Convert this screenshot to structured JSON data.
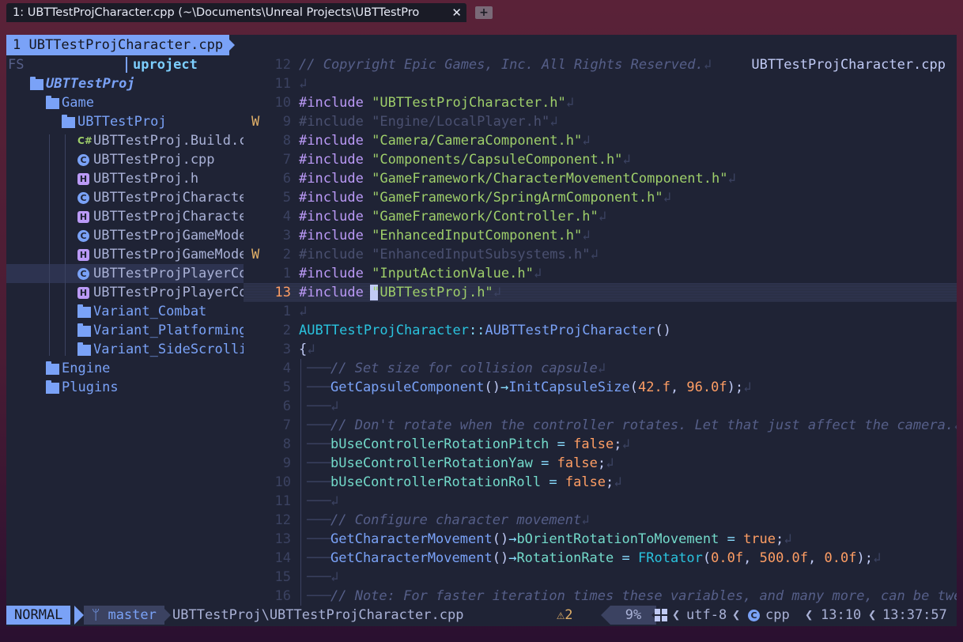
{
  "window": {
    "tab_title": "1: UBTTestProjCharacter.cpp (~\\Documents\\Unreal Projects\\UBTTestPro",
    "close_glyph": "✕",
    "new_tab_glyph": "+"
  },
  "buffer_tab": "1 UBTTestProjCharacter.cpp",
  "file_title": "UBTTestProjCharacter.cpp",
  "tree": {
    "fs_label": "FS",
    "header": "uproject",
    "items": [
      {
        "label": "UBTTestProj",
        "icon": "folder-open-icon",
        "kind": "folder",
        "depth": 0,
        "bold": true
      },
      {
        "label": "Game",
        "icon": "folder-open-icon",
        "kind": "folder",
        "depth": 1
      },
      {
        "label": "UBTTestProj",
        "icon": "folder-open-icon",
        "kind": "folder",
        "depth": 2
      },
      {
        "label": "UBTTestProj.Build.c",
        "icon": "csharp-icon",
        "kind": "cs",
        "depth": 3
      },
      {
        "label": "UBTTestProj.cpp",
        "icon": "cpp-icon",
        "kind": "cpp",
        "depth": 3
      },
      {
        "label": "UBTTestProj.h",
        "icon": "header-icon",
        "kind": "h",
        "depth": 3
      },
      {
        "label": "UBTTestProjCharacte",
        "icon": "cpp-icon",
        "kind": "cpp",
        "depth": 3
      },
      {
        "label": "UBTTestProjCharacte",
        "icon": "header-icon",
        "kind": "h",
        "depth": 3
      },
      {
        "label": "UBTTestProjGameMode",
        "icon": "cpp-icon",
        "kind": "cpp",
        "depth": 3
      },
      {
        "label": "UBTTestProjGameMode",
        "icon": "header-icon",
        "kind": "h",
        "depth": 3
      },
      {
        "label": "UBTTestProjPlayerCo",
        "icon": "cpp-icon",
        "kind": "cpp",
        "depth": 3,
        "selected": true
      },
      {
        "label": "UBTTestProjPlayerCo",
        "icon": "header-icon",
        "kind": "h",
        "depth": 3
      },
      {
        "label": "Variant_Combat",
        "icon": "folder-icon",
        "kind": "folder",
        "depth": 3
      },
      {
        "label": "Variant_Platforming",
        "icon": "folder-icon",
        "kind": "folder",
        "depth": 3
      },
      {
        "label": "Variant_SideScrolli",
        "icon": "folder-icon",
        "kind": "folder",
        "depth": 3
      },
      {
        "label": "Engine",
        "icon": "folder-icon",
        "kind": "folder",
        "depth": 1
      },
      {
        "label": "Plugins",
        "icon": "folder-icon",
        "kind": "folder",
        "depth": 1
      }
    ]
  },
  "code_lines": [
    {
      "num": "12",
      "tokens": [
        [
          "cm",
          "// Copyright Epic Games, Inc. All Rights Reserved."
        ],
        [
          "eol",
          "↲"
        ]
      ]
    },
    {
      "num": "11",
      "tokens": [
        [
          "eol",
          "↲"
        ]
      ]
    },
    {
      "num": "10",
      "tokens": [
        [
          "kw",
          "#include"
        ],
        [
          "plain",
          " "
        ],
        [
          "str",
          "\"UBTTestProjCharacter.h\""
        ],
        [
          "eol",
          "↲"
        ]
      ]
    },
    {
      "num": "9",
      "sign": "W",
      "tokens": [
        [
          "dim",
          "#include \"Engine/LocalPlayer.h\""
        ],
        [
          "eol",
          "↲"
        ]
      ]
    },
    {
      "num": "8",
      "tokens": [
        [
          "kw",
          "#include"
        ],
        [
          "plain",
          " "
        ],
        [
          "str",
          "\"Camera/CameraComponent.h\""
        ],
        [
          "eol",
          "↲"
        ]
      ]
    },
    {
      "num": "7",
      "tokens": [
        [
          "kw",
          "#include"
        ],
        [
          "plain",
          " "
        ],
        [
          "str",
          "\"Components/CapsuleComponent.h\""
        ],
        [
          "eol",
          "↲"
        ]
      ]
    },
    {
      "num": "6",
      "tokens": [
        [
          "kw",
          "#include"
        ],
        [
          "plain",
          " "
        ],
        [
          "str",
          "\"GameFramework/CharacterMovementComponent.h\""
        ],
        [
          "eol",
          "↲"
        ]
      ]
    },
    {
      "num": "5",
      "tokens": [
        [
          "kw",
          "#include"
        ],
        [
          "plain",
          " "
        ],
        [
          "str",
          "\"GameFramework/SpringArmComponent.h\""
        ],
        [
          "eol",
          "↲"
        ]
      ]
    },
    {
      "num": "4",
      "tokens": [
        [
          "kw",
          "#include"
        ],
        [
          "plain",
          " "
        ],
        [
          "str",
          "\"GameFramework/Controller.h\""
        ],
        [
          "eol",
          "↲"
        ]
      ]
    },
    {
      "num": "3",
      "tokens": [
        [
          "kw",
          "#include"
        ],
        [
          "plain",
          " "
        ],
        [
          "str",
          "\"EnhancedInputComponent.h\""
        ],
        [
          "eol",
          "↲"
        ]
      ]
    },
    {
      "num": "2",
      "sign": "W",
      "tokens": [
        [
          "dim",
          "#include \"EnhancedInputSubsystems.h\""
        ],
        [
          "eol",
          "↲"
        ]
      ]
    },
    {
      "num": "1",
      "tokens": [
        [
          "kw",
          "#include"
        ],
        [
          "plain",
          " "
        ],
        [
          "str",
          "\"InputActionValue.h\""
        ],
        [
          "eol",
          "↲"
        ]
      ]
    },
    {
      "num": "13",
      "current": true,
      "tokens": [
        [
          "kw",
          "#include"
        ],
        [
          "plain",
          " "
        ],
        [
          "str",
          "\"UBTTestProj.h\""
        ],
        [
          "eol",
          "↲"
        ]
      ]
    },
    {
      "num": "1",
      "tokens": [
        [
          "eol",
          "↲"
        ]
      ]
    },
    {
      "num": "2",
      "tokens": [
        [
          "ty",
          "AUBTTestProjCharacter"
        ],
        [
          "op",
          "::"
        ],
        [
          "fn",
          "AUBTTestProjCharacter"
        ],
        [
          "plain",
          "()"
        ]
      ]
    },
    {
      "num": "3",
      "tokens": [
        [
          "plain",
          "{"
        ],
        [
          "eol",
          "↲"
        ]
      ]
    },
    {
      "num": "4",
      "indent": 1,
      "tokens": [
        [
          "cm",
          "// Set size for collision capsule"
        ],
        [
          "eol",
          "↲"
        ]
      ]
    },
    {
      "num": "5",
      "indent": 1,
      "tokens": [
        [
          "fn",
          "GetCapsuleComponent"
        ],
        [
          "plain",
          "()"
        ],
        [
          "op",
          "→"
        ],
        [
          "fn",
          "InitCapsuleSize"
        ],
        [
          "plain",
          "("
        ],
        [
          "num",
          "42.f"
        ],
        [
          "plain",
          ", "
        ],
        [
          "num",
          "96.0f"
        ],
        [
          "plain",
          ");"
        ],
        [
          "eol",
          "↲"
        ]
      ]
    },
    {
      "num": "6",
      "indent": 1,
      "tokens": [
        [
          "eol",
          "↲"
        ]
      ]
    },
    {
      "num": "7",
      "indent": 1,
      "tokens": [
        [
          "cm",
          "// Don't rotate when the controller rotates. Let that just affect the camera."
        ],
        [
          "eol",
          "↲"
        ]
      ]
    },
    {
      "num": "8",
      "indent": 1,
      "tokens": [
        [
          "var",
          "bUseControllerRotationPitch"
        ],
        [
          "plain",
          " "
        ],
        [
          "op",
          "="
        ],
        [
          "plain",
          " "
        ],
        [
          "num",
          "false"
        ],
        [
          "plain",
          ";"
        ],
        [
          "eol",
          "↲"
        ]
      ]
    },
    {
      "num": "9",
      "indent": 1,
      "tokens": [
        [
          "var",
          "bUseControllerRotationYaw"
        ],
        [
          "plain",
          " "
        ],
        [
          "op",
          "="
        ],
        [
          "plain",
          " "
        ],
        [
          "num",
          "false"
        ],
        [
          "plain",
          ";"
        ],
        [
          "eol",
          "↲"
        ]
      ]
    },
    {
      "num": "10",
      "indent": 1,
      "tokens": [
        [
          "var",
          "bUseControllerRotationRoll"
        ],
        [
          "plain",
          " "
        ],
        [
          "op",
          "="
        ],
        [
          "plain",
          " "
        ],
        [
          "num",
          "false"
        ],
        [
          "plain",
          ";"
        ],
        [
          "eol",
          "↲"
        ]
      ]
    },
    {
      "num": "11",
      "indent": 1,
      "tokens": [
        [
          "eol",
          "↲"
        ]
      ]
    },
    {
      "num": "12",
      "indent": 1,
      "tokens": [
        [
          "cm",
          "// Configure character movement"
        ],
        [
          "eol",
          "↲"
        ]
      ]
    },
    {
      "num": "13",
      "indent": 1,
      "tokens": [
        [
          "fn",
          "GetCharacterMovement"
        ],
        [
          "plain",
          "()"
        ],
        [
          "op",
          "→"
        ],
        [
          "var",
          "bOrientRotationToMovement"
        ],
        [
          "plain",
          " "
        ],
        [
          "op",
          "="
        ],
        [
          "plain",
          " "
        ],
        [
          "num",
          "true"
        ],
        [
          "plain",
          ";"
        ],
        [
          "eol",
          "↲"
        ]
      ]
    },
    {
      "num": "14",
      "indent": 1,
      "tokens": [
        [
          "fn",
          "GetCharacterMovement"
        ],
        [
          "plain",
          "()"
        ],
        [
          "op",
          "→"
        ],
        [
          "var",
          "RotationRate"
        ],
        [
          "plain",
          " "
        ],
        [
          "op",
          "="
        ],
        [
          "plain",
          " "
        ],
        [
          "ty",
          "FRotator"
        ],
        [
          "plain",
          "("
        ],
        [
          "num",
          "0.0f"
        ],
        [
          "plain",
          ", "
        ],
        [
          "num",
          "500.0f"
        ],
        [
          "plain",
          ", "
        ],
        [
          "num",
          "0.0f"
        ],
        [
          "plain",
          ");"
        ],
        [
          "eol",
          "↲"
        ]
      ]
    },
    {
      "num": "15",
      "indent": 1,
      "tokens": [
        [
          "eol",
          "↲"
        ]
      ]
    },
    {
      "num": "16",
      "indent": 1,
      "tokens": [
        [
          "cm",
          "// Note: For faster iteration times these variables, and many more, can be twea"
        ]
      ]
    }
  ],
  "status": {
    "mode": "NORMAL",
    "branch_icon": "ᛘ",
    "branch": "master",
    "path": "UBTTestProj\\UBTTestProjCharacter.cpp",
    "warn_icon": "⚠",
    "warn_count": "2",
    "percent": "9%",
    "os_icon": "windows-icon",
    "encoding": "utf-8",
    "filetype": "cpp",
    "position": "13:10",
    "clock": "13:37:57"
  }
}
